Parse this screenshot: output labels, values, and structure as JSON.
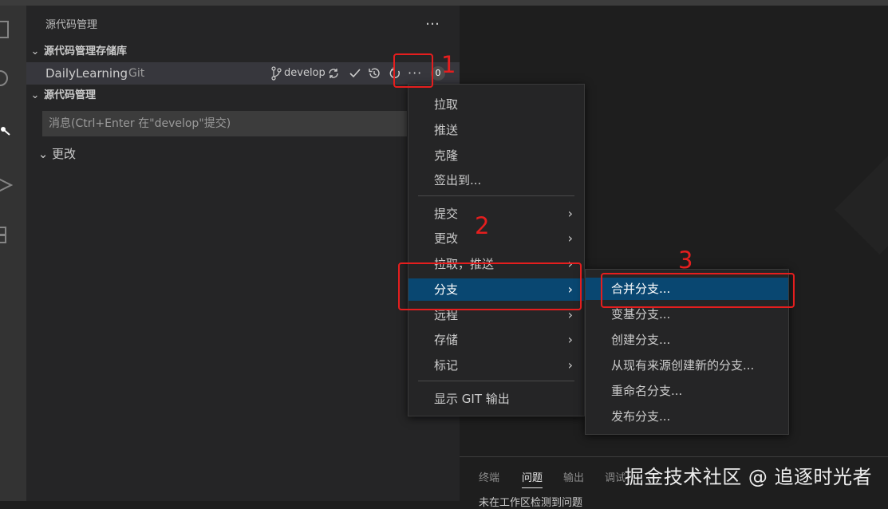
{
  "sidebar": {
    "title": "源代码管理",
    "more_icon": "…",
    "repos_section": "源代码管理存储库",
    "repo": {
      "name": "DailyLearning",
      "type": "Git",
      "branch": "develop",
      "more_icon": "···",
      "badge": "0"
    },
    "scm_section": "源代码管理",
    "commit_placeholder": "消息(Ctrl+Enter 在\"develop\"提交)",
    "changes_label": "更改"
  },
  "main_menu": {
    "items": [
      {
        "label": "拉取"
      },
      {
        "label": "推送"
      },
      {
        "label": "克隆"
      },
      {
        "label": "签出到..."
      },
      {
        "label": "提交"
      },
      {
        "label": "更改"
      },
      {
        "label": "拉取，推送"
      },
      {
        "label": "分支"
      },
      {
        "label": "远程"
      },
      {
        "label": "存储"
      },
      {
        "label": "标记"
      },
      {
        "label": "显示 GIT 输出"
      }
    ],
    "submenu_arrow": "›",
    "selected": "分支"
  },
  "branch_menu": {
    "items": [
      {
        "label": "合并分支..."
      },
      {
        "label": "变基分支..."
      },
      {
        "label": "创建分支..."
      },
      {
        "label": "从现有来源创建新的分支..."
      },
      {
        "label": "重命名分支..."
      },
      {
        "label": "发布分支..."
      }
    ],
    "selected": "合并分支..."
  },
  "panel": {
    "tabs": [
      {
        "label": "终端"
      },
      {
        "label": "问题"
      },
      {
        "label": "输出"
      },
      {
        "label": "调试"
      }
    ],
    "active_tab": "问题",
    "message": "未在工作区检测到问题"
  },
  "annotations": [
    "1",
    "2",
    "3"
  ],
  "watermark": "掘金技术社区 @ 追逐时光者",
  "colors": {
    "sidebar_bg": "#252526",
    "selection": "#094771",
    "annotation_red": "#e51e1e"
  }
}
